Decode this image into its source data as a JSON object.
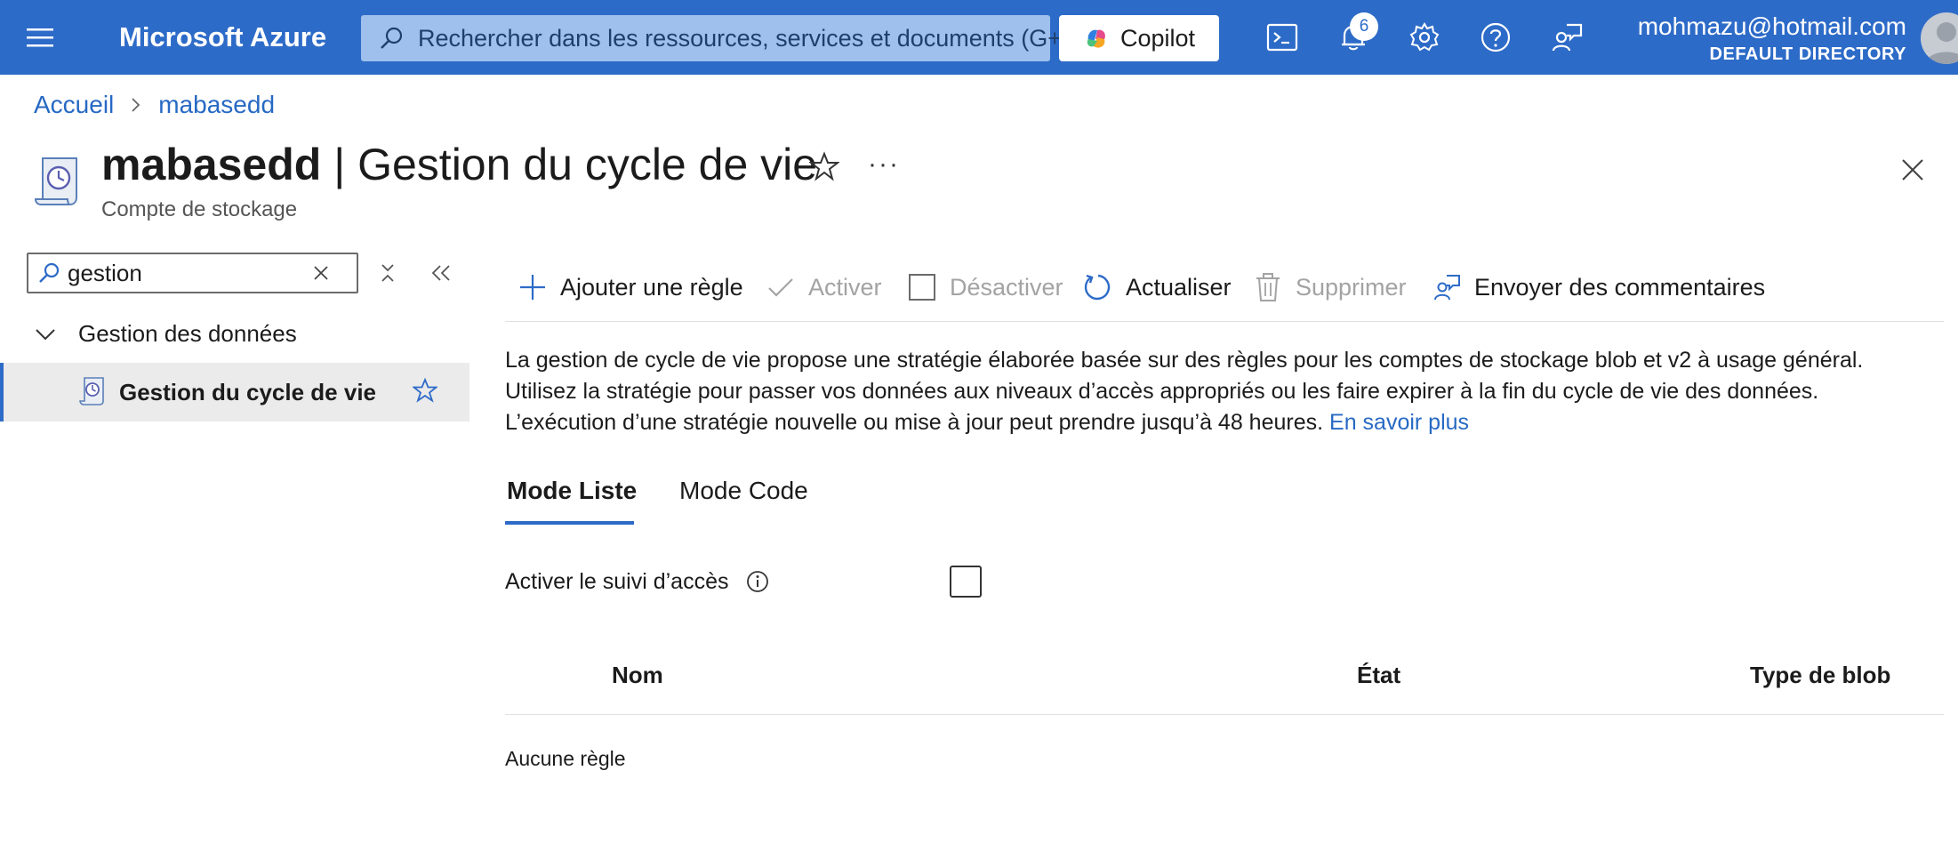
{
  "colors": {
    "topbar": "#2d6bc8",
    "link": "#2769c3",
    "search_bg": "#9fc0ec",
    "active_menu_bg": "#ebebeb",
    "disabled_text": "#a3a3a3"
  },
  "topbar": {
    "brand": "Microsoft Azure",
    "search_placeholder": "Rechercher dans les ressources, services et documents (G+/)",
    "copilot_label": "Copilot",
    "notification_count": "6",
    "icons": [
      "menu-icon",
      "search-icon",
      "copilot-icon",
      "cloud-shell-icon",
      "bell-icon",
      "gear-icon",
      "help-icon",
      "feedback-icon",
      "avatar"
    ],
    "account_email": "mohmazu@hotmail.com",
    "account_directory": "DEFAULT DIRECTORY"
  },
  "breadcrumb": {
    "items": [
      "Accueil",
      "mabasedd"
    ]
  },
  "header": {
    "resource_name": "mabasedd",
    "title_separator": " | ",
    "page_name": "Gestion du cycle de vie",
    "subtitle": "Compte de stockage",
    "more_label": "···"
  },
  "sidebar": {
    "search_value": "gestion",
    "group_label": "Gestion des données",
    "active_item_label": "Gestion du cycle de vie"
  },
  "commands": [
    {
      "label": "Ajouter une règle",
      "icon": "plus-icon",
      "enabled": true
    },
    {
      "label": "Activer",
      "icon": "check-icon",
      "enabled": false
    },
    {
      "label": "Désactiver",
      "icon": "square-icon",
      "enabled": false
    },
    {
      "label": "Actualiser",
      "icon": "refresh-icon",
      "enabled": true
    },
    {
      "label": "Supprimer",
      "icon": "trash-icon",
      "enabled": false
    },
    {
      "label": "Envoyer des commentaires",
      "icon": "feedback-icon",
      "enabled": true
    }
  ],
  "description": {
    "line1": "La gestion de cycle de vie propose une stratégie élaborée basée sur des règles pour les comptes de stockage blob et v2 à usage général.",
    "line2": "Utilisez la stratégie pour passer vos données aux niveaux d’accès appropriés ou les faire expirer à la fin du cycle de vie des données.",
    "line3": "L’exécution d’une stratégie nouvelle ou mise à jour peut prendre jusqu’à 48 heures.",
    "link": "En savoir plus"
  },
  "tabs": [
    {
      "label": "Mode Liste",
      "active": true
    },
    {
      "label": "Mode Code",
      "active": false
    }
  ],
  "access_tracking": {
    "label": "Activer le suivi d’accès",
    "checked": false
  },
  "table": {
    "columns": [
      "Nom",
      "État",
      "Type de blob"
    ],
    "empty_text": "Aucune règle"
  }
}
